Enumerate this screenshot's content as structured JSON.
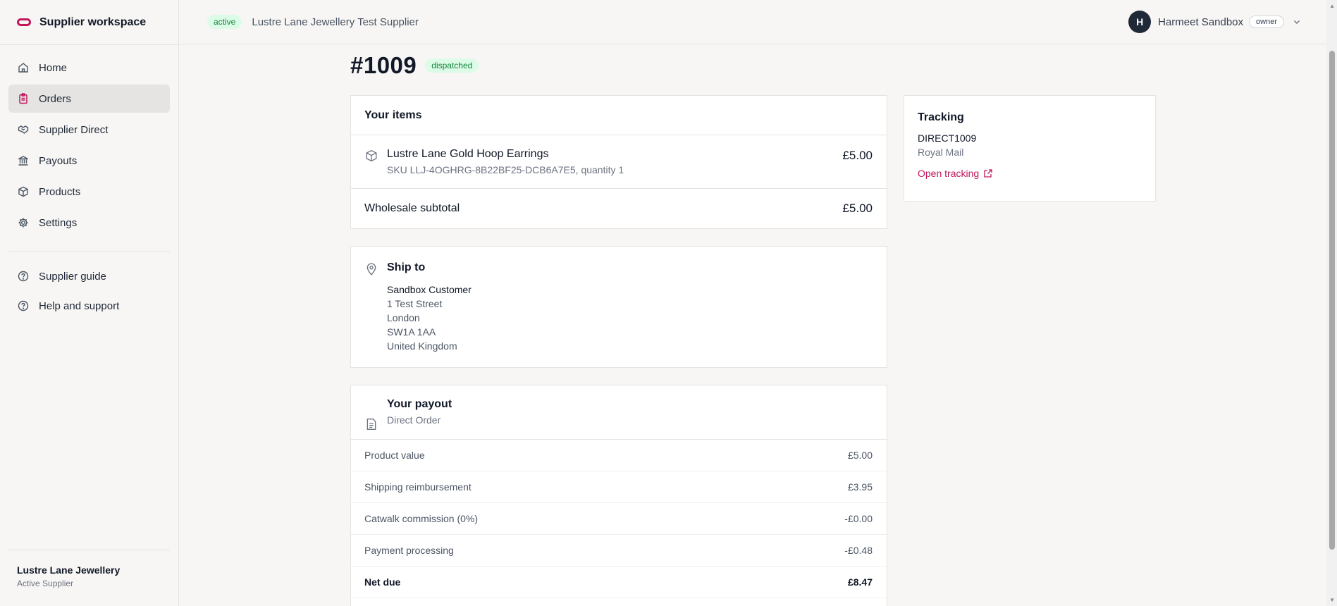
{
  "sidebar": {
    "brand": "Supplier workspace",
    "nav": [
      {
        "label": "Home",
        "icon": "home-icon"
      },
      {
        "label": "Orders",
        "icon": "clipboard-icon",
        "active": true
      },
      {
        "label": "Supplier Direct",
        "icon": "handshake-icon"
      },
      {
        "label": "Payouts",
        "icon": "bank-icon"
      },
      {
        "label": "Products",
        "icon": "box-icon"
      },
      {
        "label": "Settings",
        "icon": "gear-icon"
      }
    ],
    "help": [
      {
        "label": "Supplier guide",
        "icon": "help-circle-icon"
      },
      {
        "label": "Help and support",
        "icon": "help-circle-icon"
      }
    ],
    "footer": {
      "name": "Lustre Lane Jewellery",
      "role": "Active Supplier"
    }
  },
  "topbar": {
    "status": "active",
    "supplier": "Lustre Lane Jewellery Test Supplier",
    "user": {
      "initial": "H",
      "name": "Harmeet Sandbox",
      "role": "owner"
    }
  },
  "order": {
    "number": "#1009",
    "status": "dispatched"
  },
  "items": {
    "title": "Your items",
    "list": [
      {
        "name": "Lustre Lane Gold Hoop Earrings",
        "sku": "SKU LLJ-4OGHRG-8B22BF25-DCB6A7E5, quantity 1",
        "price": "£5.00"
      }
    ],
    "subtotal_label": "Wholesale subtotal",
    "subtotal_value": "£5.00"
  },
  "ship": {
    "title": "Ship to",
    "name": "Sandbox Customer",
    "lines": [
      "1 Test Street",
      "London",
      "SW1A 1AA",
      "United Kingdom"
    ]
  },
  "payout": {
    "title": "Your payout",
    "subtitle": "Direct Order",
    "rows": [
      {
        "label": "Product value",
        "value": "£5.00"
      },
      {
        "label": "Shipping reimbursement",
        "value": "£3.95"
      },
      {
        "label": "Catwalk commission (0%)",
        "value": "-£0.00"
      },
      {
        "label": "Payment processing",
        "value": "-£0.48"
      },
      {
        "label": "Net due",
        "value": "£8.47"
      }
    ]
  },
  "tracking": {
    "title": "Tracking",
    "code": "DIRECT1009",
    "carrier": "Royal Mail",
    "link": "Open tracking"
  },
  "colors": {
    "accent": "#be185d",
    "success_bg": "#dcfce7",
    "success_text": "#15803d"
  }
}
